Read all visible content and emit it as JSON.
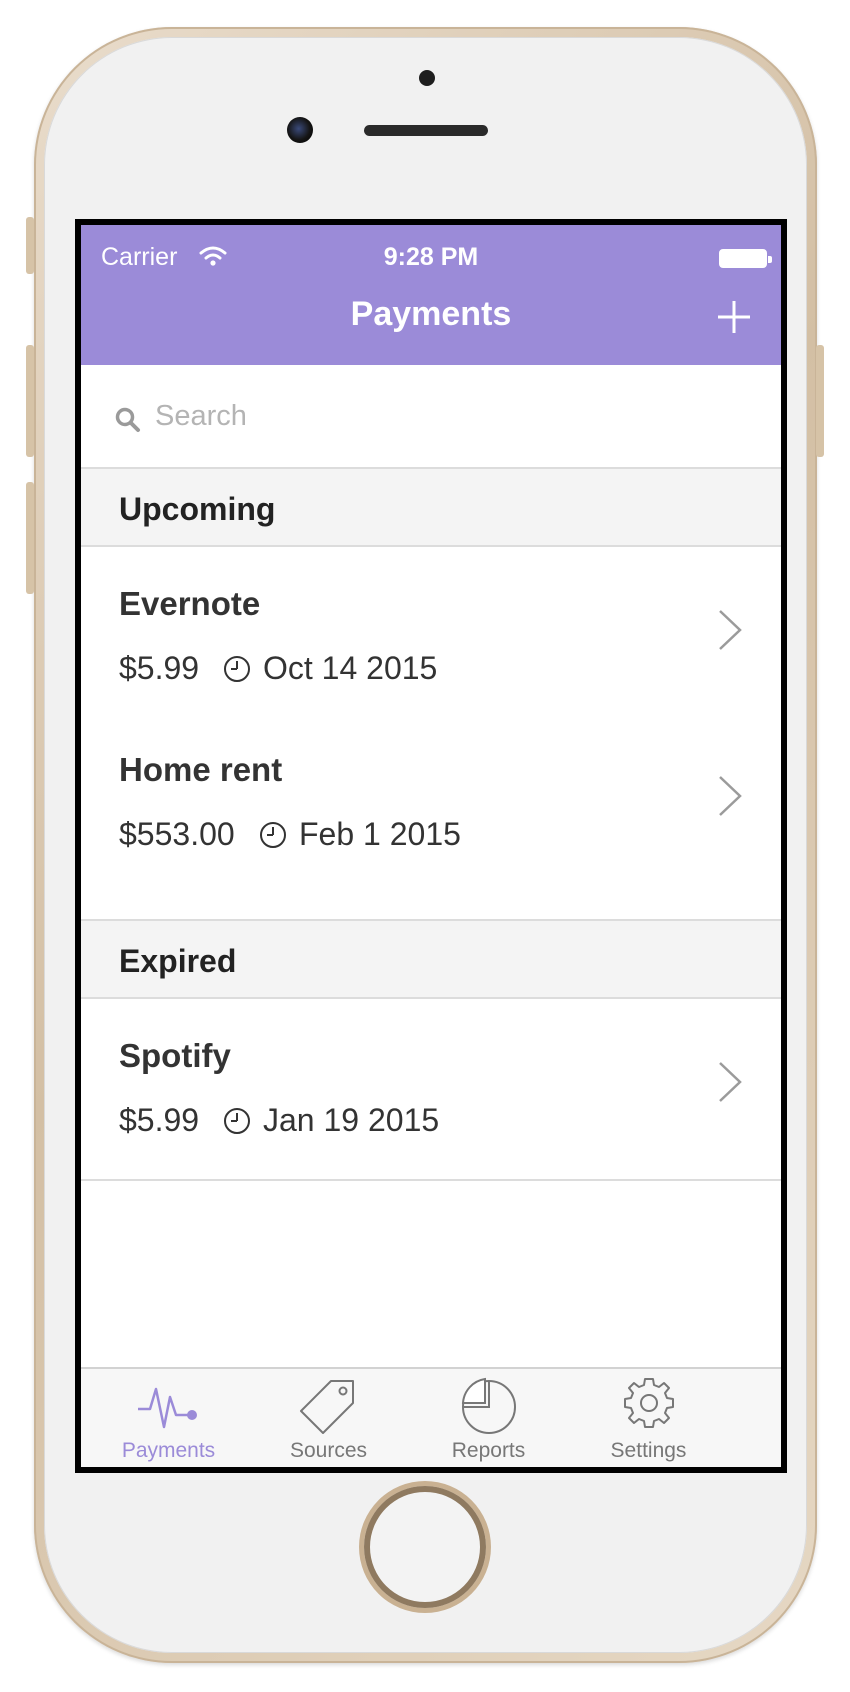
{
  "status_bar": {
    "carrier": "Carrier",
    "time": "9:28 PM"
  },
  "navbar": {
    "title": "Payments",
    "add_icon": "plus-icon"
  },
  "search": {
    "placeholder": "Search",
    "value": ""
  },
  "sections": [
    {
      "title": "Upcoming",
      "items": [
        {
          "name": "Evernote",
          "amount": "$5.99",
          "date": "Oct 14 2015"
        },
        {
          "name": "Home rent",
          "amount": "$553.00",
          "date": "Feb 1 2015"
        }
      ]
    },
    {
      "title": "Expired",
      "items": [
        {
          "name": "Spotify",
          "amount": "$5.99",
          "date": "Jan 19 2015"
        }
      ]
    }
  ],
  "tabs": [
    {
      "label": "Payments",
      "icon": "pulse-icon",
      "active": true
    },
    {
      "label": "Sources",
      "icon": "tag-icon",
      "active": false
    },
    {
      "label": "Reports",
      "icon": "pie-chart-icon",
      "active": false
    },
    {
      "label": "Settings",
      "icon": "gear-icon",
      "active": false
    }
  ],
  "colors": {
    "accent": "#9b8bd8",
    "section_bg": "#f4f4f4",
    "divider": "#dcdcdc"
  }
}
